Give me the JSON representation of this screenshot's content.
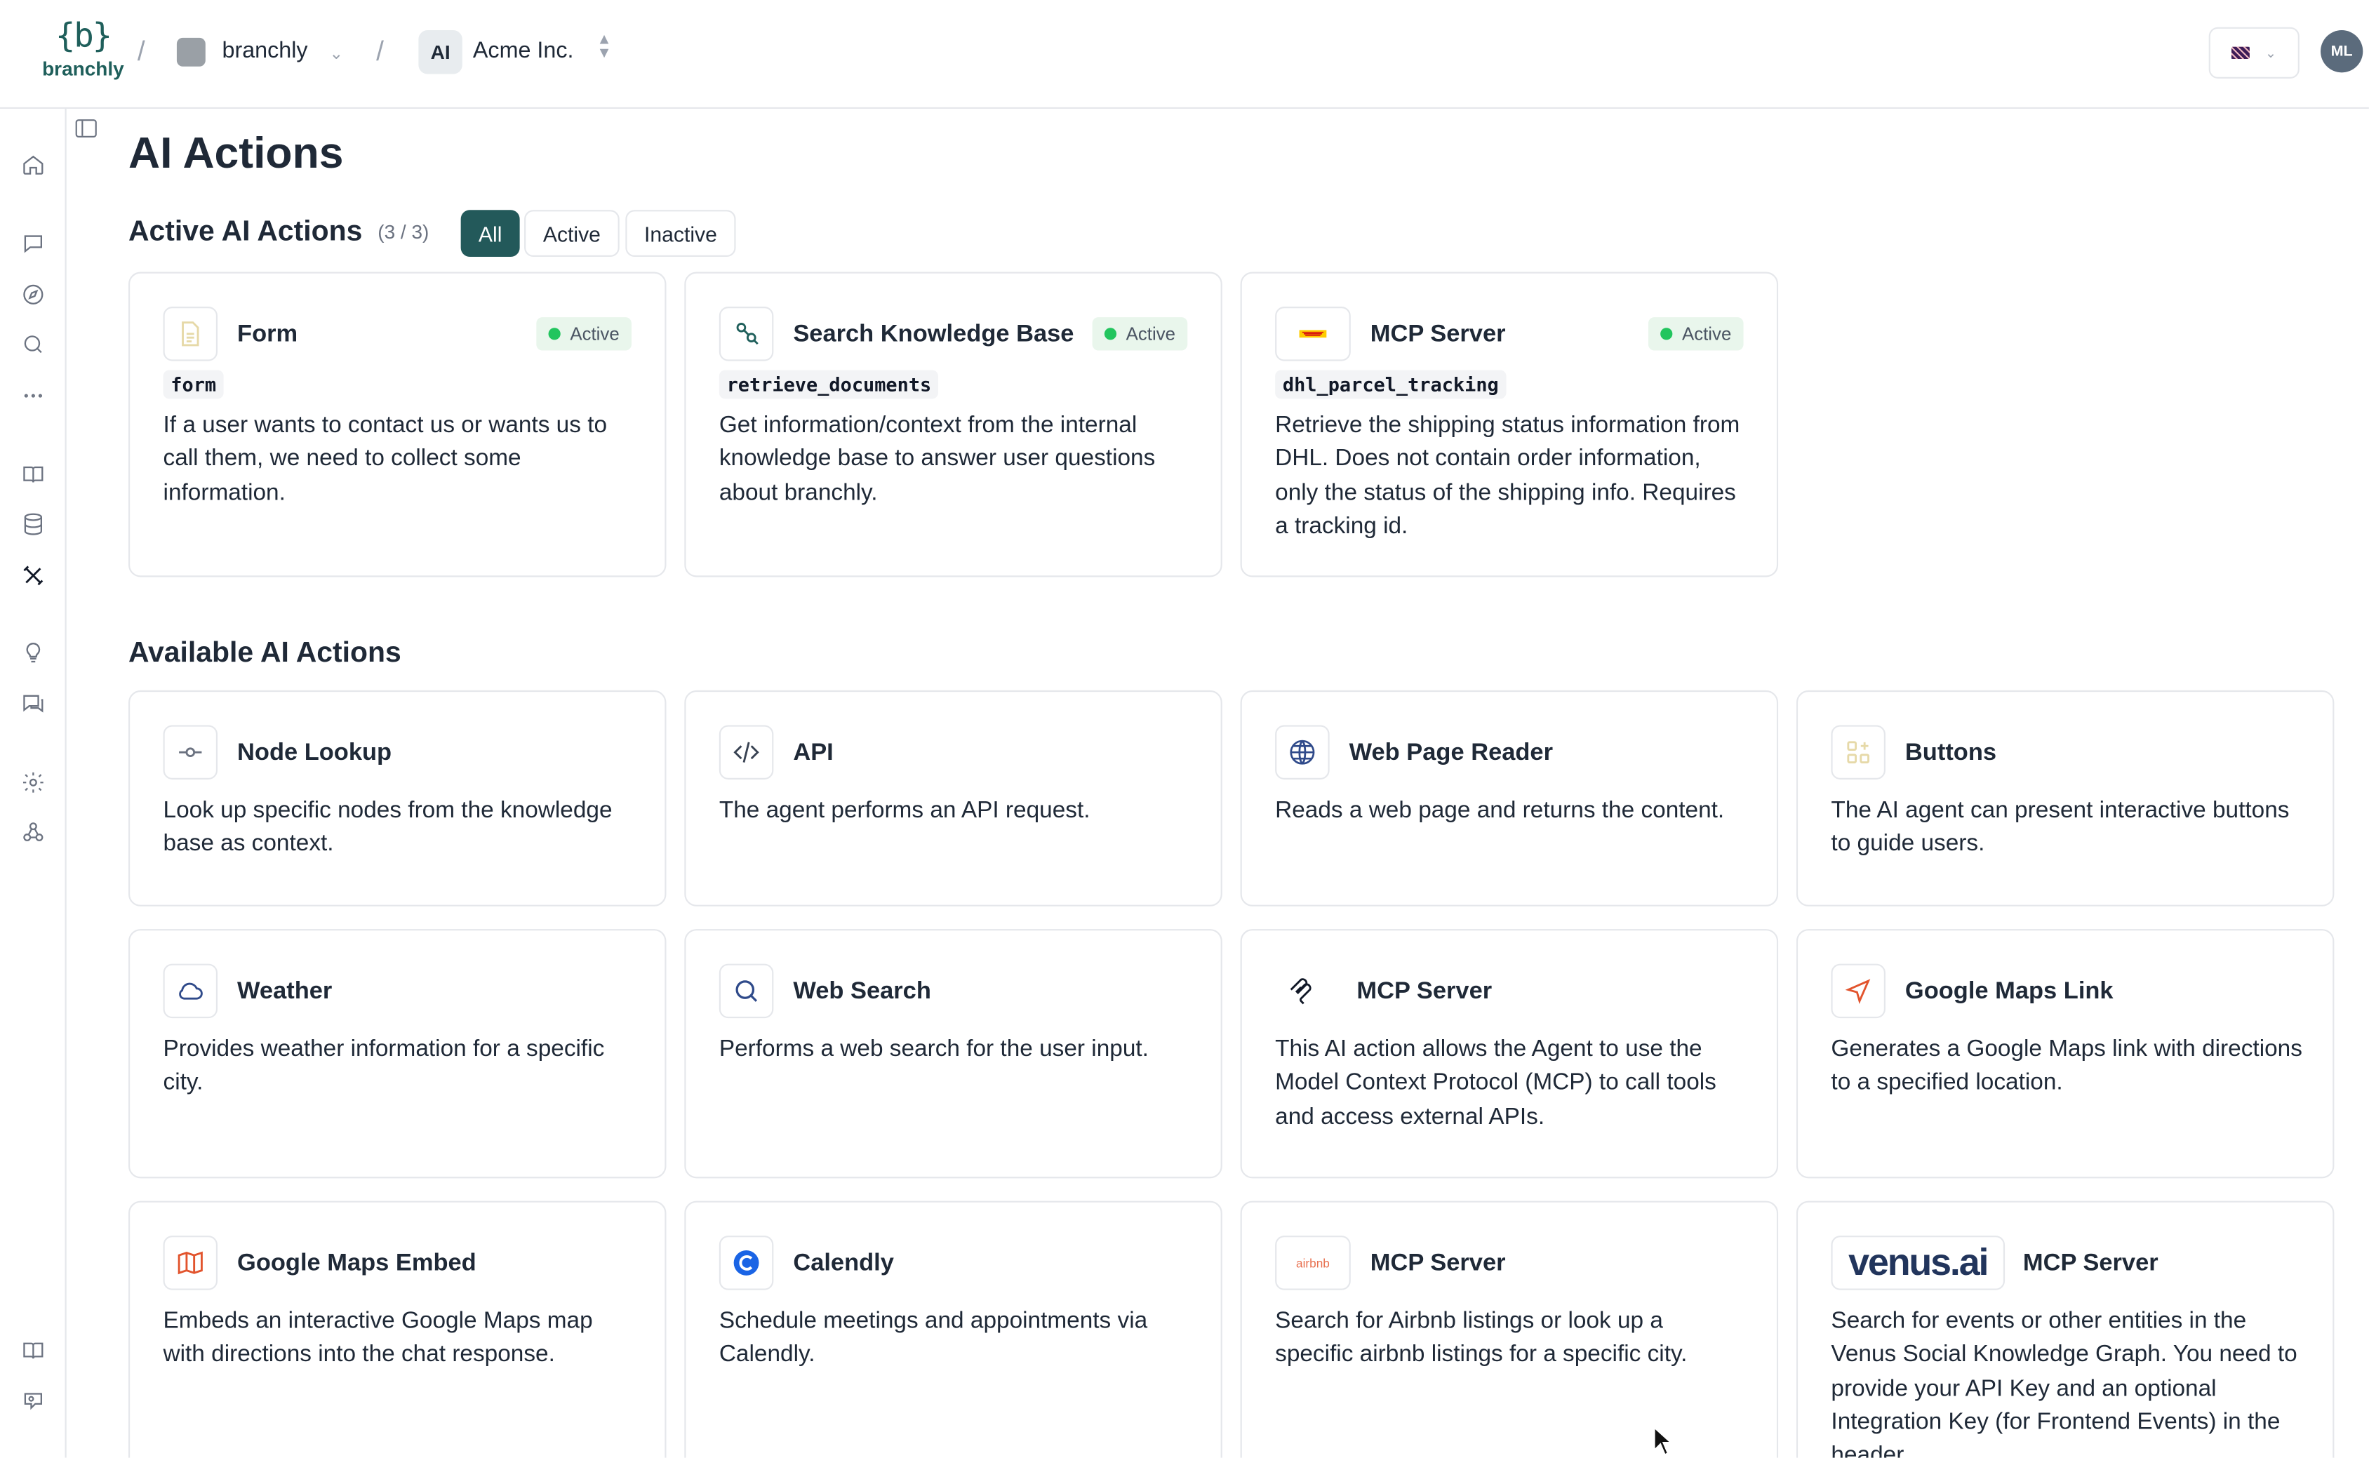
{
  "header": {
    "logo_text": "branchly",
    "logo_braces": "{b}",
    "separator": "/",
    "workspace": "branchly",
    "org_badge": "AI",
    "org_name": "Acme Inc.",
    "user_initials": "ML",
    "language": "en-GB"
  },
  "page": {
    "title": "AI Actions",
    "active_section": "Active AI Actions",
    "active_count": "(3 / 3)",
    "filters": [
      "All",
      "Active",
      "Inactive"
    ],
    "available_section": "Available AI Actions"
  },
  "active_actions": [
    {
      "name": "Form",
      "status": "Active",
      "code": "form",
      "description": "If a user wants to contact us or wants us to call them, we need to collect some information.",
      "icon": "document-icon"
    },
    {
      "name": "Search Knowledge Base",
      "status": "Active",
      "code": "retrieve_documents",
      "description": "Get information/context from the internal knowledge base to answer user questions about branchly.",
      "icon": "knowledge-search-icon"
    },
    {
      "name": "MCP Server",
      "status": "Active",
      "code": "dhl_parcel_tracking",
      "description": "Retrieve the shipping status information from DHL. Does not contain order information, only the status of the shipping info. Requires a tracking id.",
      "icon": "dhl-logo-icon"
    }
  ],
  "available_actions": [
    {
      "name": "Node Lookup",
      "description": "Look up specific nodes from the knowledge base as context.",
      "icon": "node-commit-icon"
    },
    {
      "name": "API",
      "description": "The agent performs an API request.",
      "icon": "code-icon"
    },
    {
      "name": "Web Page Reader",
      "description": "Reads a web page and returns the content.",
      "icon": "globe-icon"
    },
    {
      "name": "Buttons",
      "description": "The AI agent can present interactive buttons to guide users.",
      "icon": "grid-plus-icon"
    },
    {
      "name": "Weather",
      "description": "Provides weather information for a specific city.",
      "icon": "cloud-icon"
    },
    {
      "name": "Web Search",
      "description": "Performs a web search for the user input.",
      "icon": "search-icon"
    },
    {
      "name": "MCP Server",
      "description": "This AI action allows the Agent to use the Model Context Protocol (MCP) to call tools and access external APIs.",
      "icon": "mcp-logo-icon"
    },
    {
      "name": "Google Maps Link",
      "description": "Generates a Google Maps link with directions to a specified location.",
      "icon": "navigation-arrow-icon"
    },
    {
      "name": "Google Maps Embed",
      "description": "Embeds an interactive Google Maps map with directions into the chat response.",
      "icon": "map-icon"
    },
    {
      "name": "Calendly",
      "description": "Schedule meetings and appointments via Calendly.",
      "icon": "calendly-logo-icon"
    },
    {
      "name": "MCP Server",
      "description": "Search for Airbnb listings or look up a specific airbnb listings for a specific city.",
      "icon": "airbnb-logo-icon",
      "logo_text": "airbnb"
    },
    {
      "name": "MCP Server",
      "description": "Search for events or other entities in the Venus Social Knowledge Graph. You need to provide your API Key and an optional Integration Key (for Frontend Events) in the header.",
      "icon": "venus-ai-logo-icon",
      "logo_text": "venus.ai"
    }
  ],
  "colors": {
    "accent": "#23595a",
    "status_green": "#22c55e",
    "badge_bg": "#e9f6ec"
  }
}
